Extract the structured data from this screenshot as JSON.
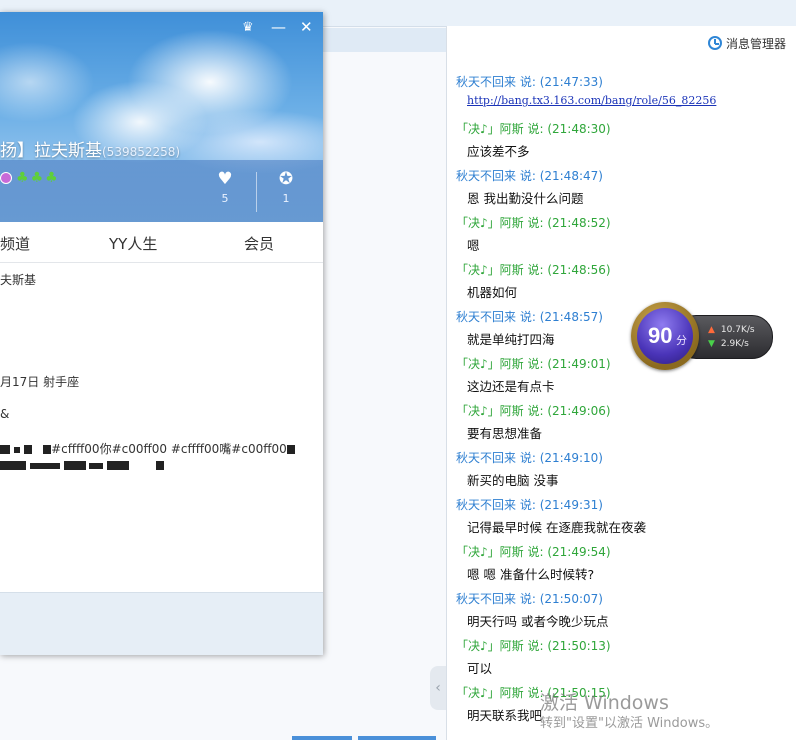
{
  "chat": {
    "manager_label": "消息管理器",
    "messages": [
      {
        "sender": "秋天不回来 说:",
        "time": "(21:47:33)",
        "text": "http://bang.tx3.163.com/bang/role/56_82256",
        "kind": "a",
        "link": true
      },
      {
        "sender": "「决♪」阿斯 说:",
        "time": "(21:48:30)",
        "text": "应该差不多",
        "kind": "b"
      },
      {
        "sender": "秋天不回来 说:",
        "time": "(21:48:47)",
        "text": "恩 我出勤没什么问题",
        "kind": "a"
      },
      {
        "sender": "「决♪」阿斯 说:",
        "time": "(21:48:52)",
        "text": "嗯",
        "kind": "b"
      },
      {
        "sender": "「决♪」阿斯 说:",
        "time": "(21:48:56)",
        "text": "机器如何",
        "kind": "b"
      },
      {
        "sender": "秋天不回来 说:",
        "time": "(21:48:57)",
        "text": "就是单纯打四海",
        "kind": "a"
      },
      {
        "sender": "「决♪」阿斯 说:",
        "time": "(21:49:01)",
        "text": "这边还是有点卡",
        "kind": "b"
      },
      {
        "sender": "「决♪」阿斯 说:",
        "time": "(21:49:06)",
        "text": "要有思想准备",
        "kind": "b"
      },
      {
        "sender": "秋天不回来 说:",
        "time": "(21:49:10)",
        "text": "新买的电脑 没事",
        "kind": "a"
      },
      {
        "sender": "秋天不回来 说:",
        "time": "(21:49:31)",
        "text": "记得最早时候 在逐鹿我就在夜袭",
        "kind": "a"
      },
      {
        "sender": "「决♪」阿斯 说:",
        "time": "(21:49:54)",
        "text": "嗯 嗯  准备什么时候转?",
        "kind": "b"
      },
      {
        "sender": "秋天不回来 说:",
        "time": "(21:50:07)",
        "text": "明天行吗 或者今晚少玩点",
        "kind": "a"
      },
      {
        "sender": "「决♪」阿斯 说:",
        "time": "(21:50:13)",
        "text": "可以",
        "kind": "b"
      },
      {
        "sender": "「决♪」阿斯 说:",
        "time": "(21:50:15)",
        "text": "明天联系我吧",
        "kind": "b"
      }
    ]
  },
  "speed_widget": {
    "score": "90",
    "score_unit": "分",
    "upload": "10.7K/s",
    "download": "2.9K/s"
  },
  "profile": {
    "name": "扬】拉夫斯基",
    "id": "(539852258)",
    "likes": "5",
    "awards": "1",
    "tabs": [
      "频道",
      "YY人生",
      "会员"
    ],
    "info_name": "夫斯基",
    "birthday": "月17日   射手座",
    "info_mark": "&",
    "signature": "#cffff00你#c00ff00 #cffff00嘴#c00ff00"
  },
  "watermark": {
    "line1": "激活 Windows",
    "line2": "转到\"设置\"以激活 Windows。"
  }
}
